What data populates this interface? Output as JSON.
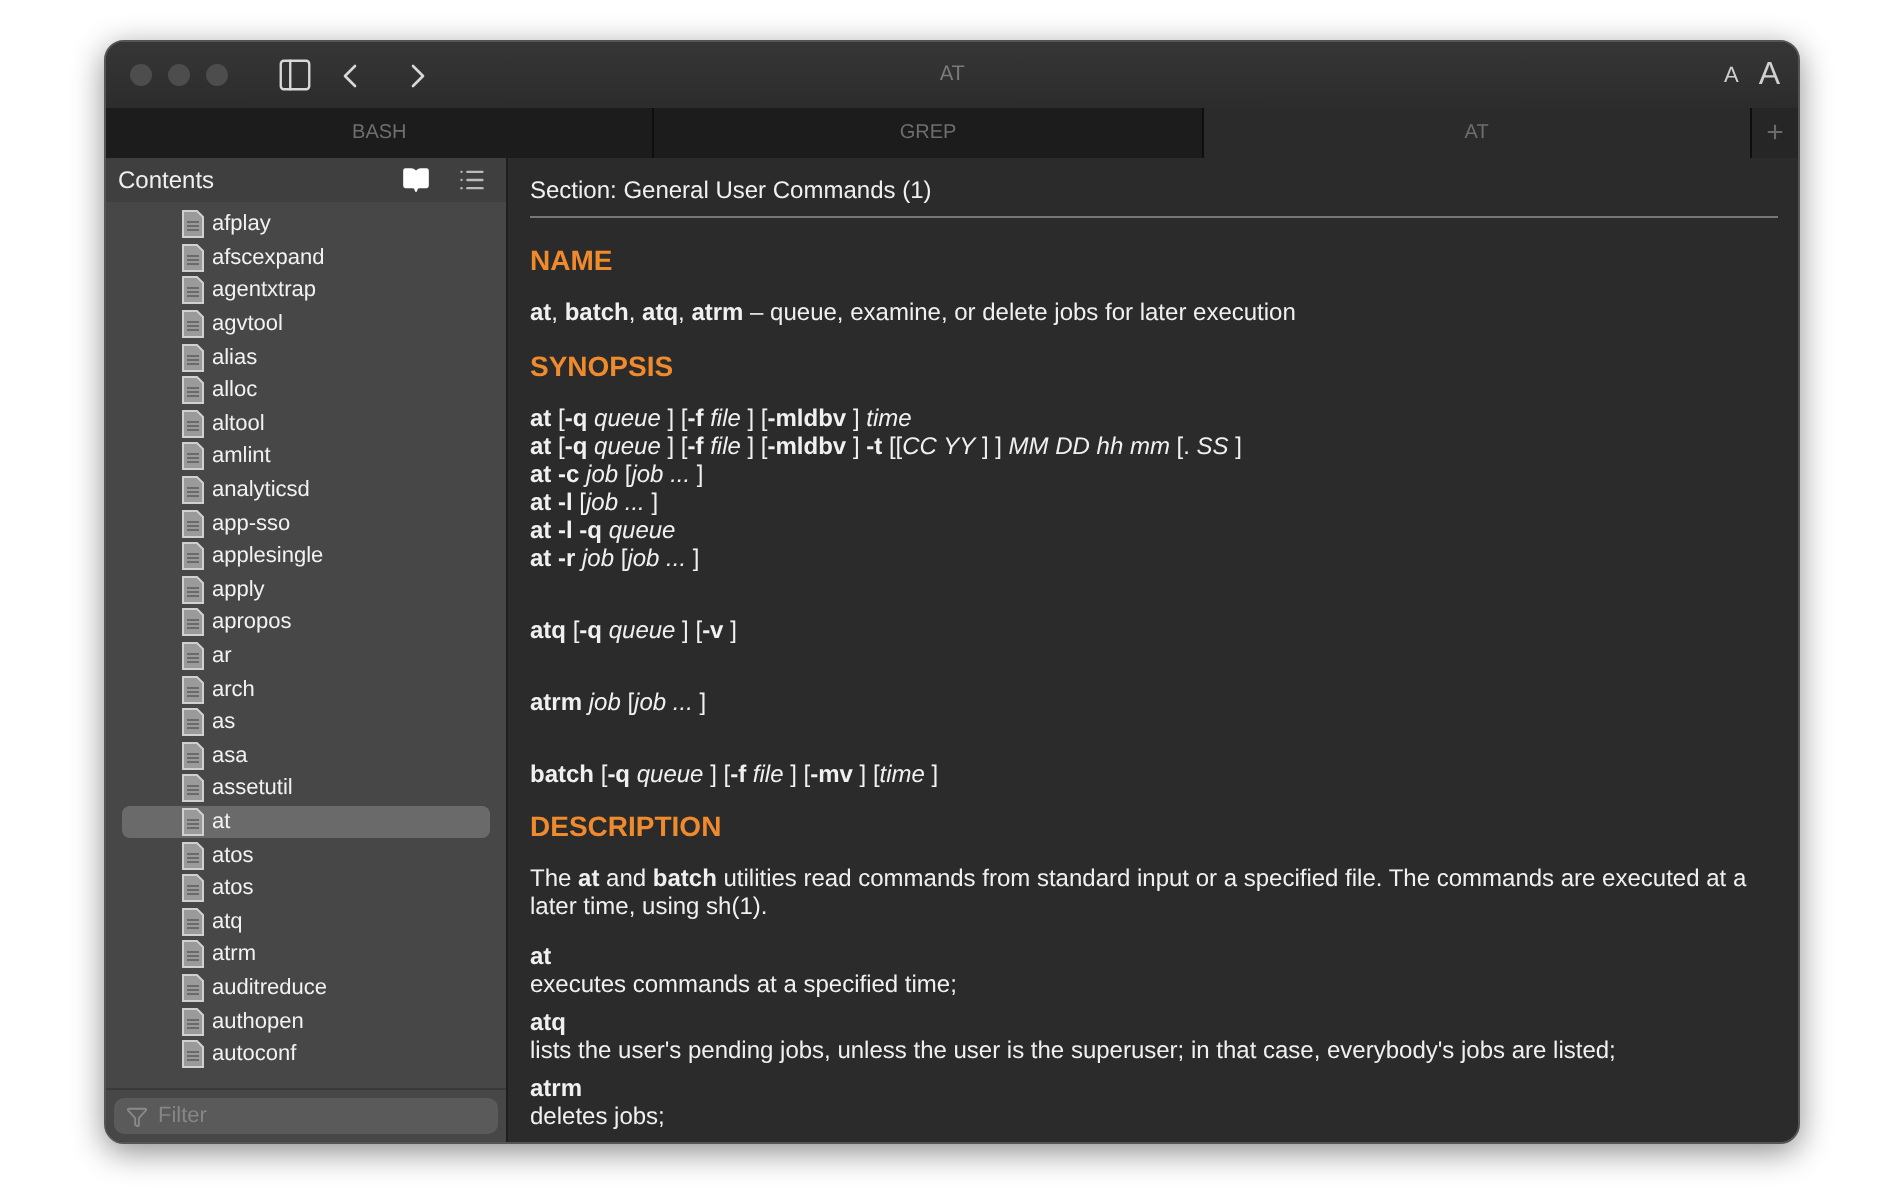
{
  "window": {
    "title": "AT",
    "font_buttons": [
      "A",
      "A"
    ]
  },
  "tabs": [
    {
      "label": "BASH",
      "selected": false
    },
    {
      "label": "GREP",
      "selected": false
    },
    {
      "label": "AT",
      "selected": true
    }
  ],
  "new_tab": "+",
  "sidebar": {
    "title": "Contents",
    "items": [
      {
        "label": "afplay",
        "selected": false
      },
      {
        "label": "afscexpand",
        "selected": false
      },
      {
        "label": "agentxtrap",
        "selected": false
      },
      {
        "label": "agvtool",
        "selected": false
      },
      {
        "label": "alias",
        "selected": false
      },
      {
        "label": "alloc",
        "selected": false
      },
      {
        "label": "altool",
        "selected": false
      },
      {
        "label": "amlint",
        "selected": false
      },
      {
        "label": "analyticsd",
        "selected": false
      },
      {
        "label": "app-sso",
        "selected": false
      },
      {
        "label": "applesingle",
        "selected": false
      },
      {
        "label": "apply",
        "selected": false
      },
      {
        "label": "apropos",
        "selected": false
      },
      {
        "label": "ar",
        "selected": false
      },
      {
        "label": "arch",
        "selected": false
      },
      {
        "label": "as",
        "selected": false
      },
      {
        "label": "asa",
        "selected": false
      },
      {
        "label": "assetutil",
        "selected": false
      },
      {
        "label": "at",
        "selected": true
      },
      {
        "label": "atos",
        "selected": false
      },
      {
        "label": "atos",
        "selected": false
      },
      {
        "label": "atq",
        "selected": false
      },
      {
        "label": "atrm",
        "selected": false
      },
      {
        "label": "auditreduce",
        "selected": false
      },
      {
        "label": "authopen",
        "selected": false
      },
      {
        "label": "autoconf",
        "selected": false
      }
    ],
    "filter_placeholder": "Filter"
  },
  "page": {
    "section": "Section: General User Commands (1)",
    "blocks": [
      {
        "kind": "heading",
        "text": "NAME"
      },
      {
        "kind": "para",
        "text": "**at**, **batch**, **atq**, **atrm** – queue, examine, or delete jobs for later execution"
      },
      {
        "kind": "heading",
        "text": "SYNOPSIS"
      },
      {
        "kind": "synopsis",
        "lines": [
          "**at** [**-q** *queue* ] [**-f** *file* ] [**-mldbv** ] *time*",
          "**at** [**-q** *queue* ] [**-f** *file* ] [**-mldbv** ] **-t** [[*CC YY* ] ] *MM DD hh mm* [. *SS* ]",
          "**at -c** *job* [*job ...* ]",
          "**at -l** [*job ...* ]",
          "**at -l -q** *queue*",
          "**at -r** *job* [*job ...* ]"
        ]
      },
      {
        "kind": "command",
        "text": "**atq** [**-q** *queue* ] [**-v** ]"
      },
      {
        "kind": "command",
        "text": "**atrm** *job* [*job ...* ]"
      },
      {
        "kind": "command",
        "text": "**batch** [**-q** *queue* ] [**-f** *file* ] [**-mv** ] [*time* ]"
      },
      {
        "kind": "heading",
        "text": "DESCRIPTION"
      },
      {
        "kind": "para",
        "text": "The **at** and **batch** utilities read commands from standard input or a specified file. The commands are executed at a later time, using sh(1)."
      },
      {
        "kind": "term",
        "term": "at",
        "desc": "executes commands at a specified time;"
      },
      {
        "kind": "term",
        "term": "atq",
        "desc": "lists the user's pending jobs, unless the user is the superuser; in that case, everybody's jobs are listed;"
      },
      {
        "kind": "term",
        "term": "atrm",
        "desc": "deletes jobs;"
      }
    ]
  }
}
